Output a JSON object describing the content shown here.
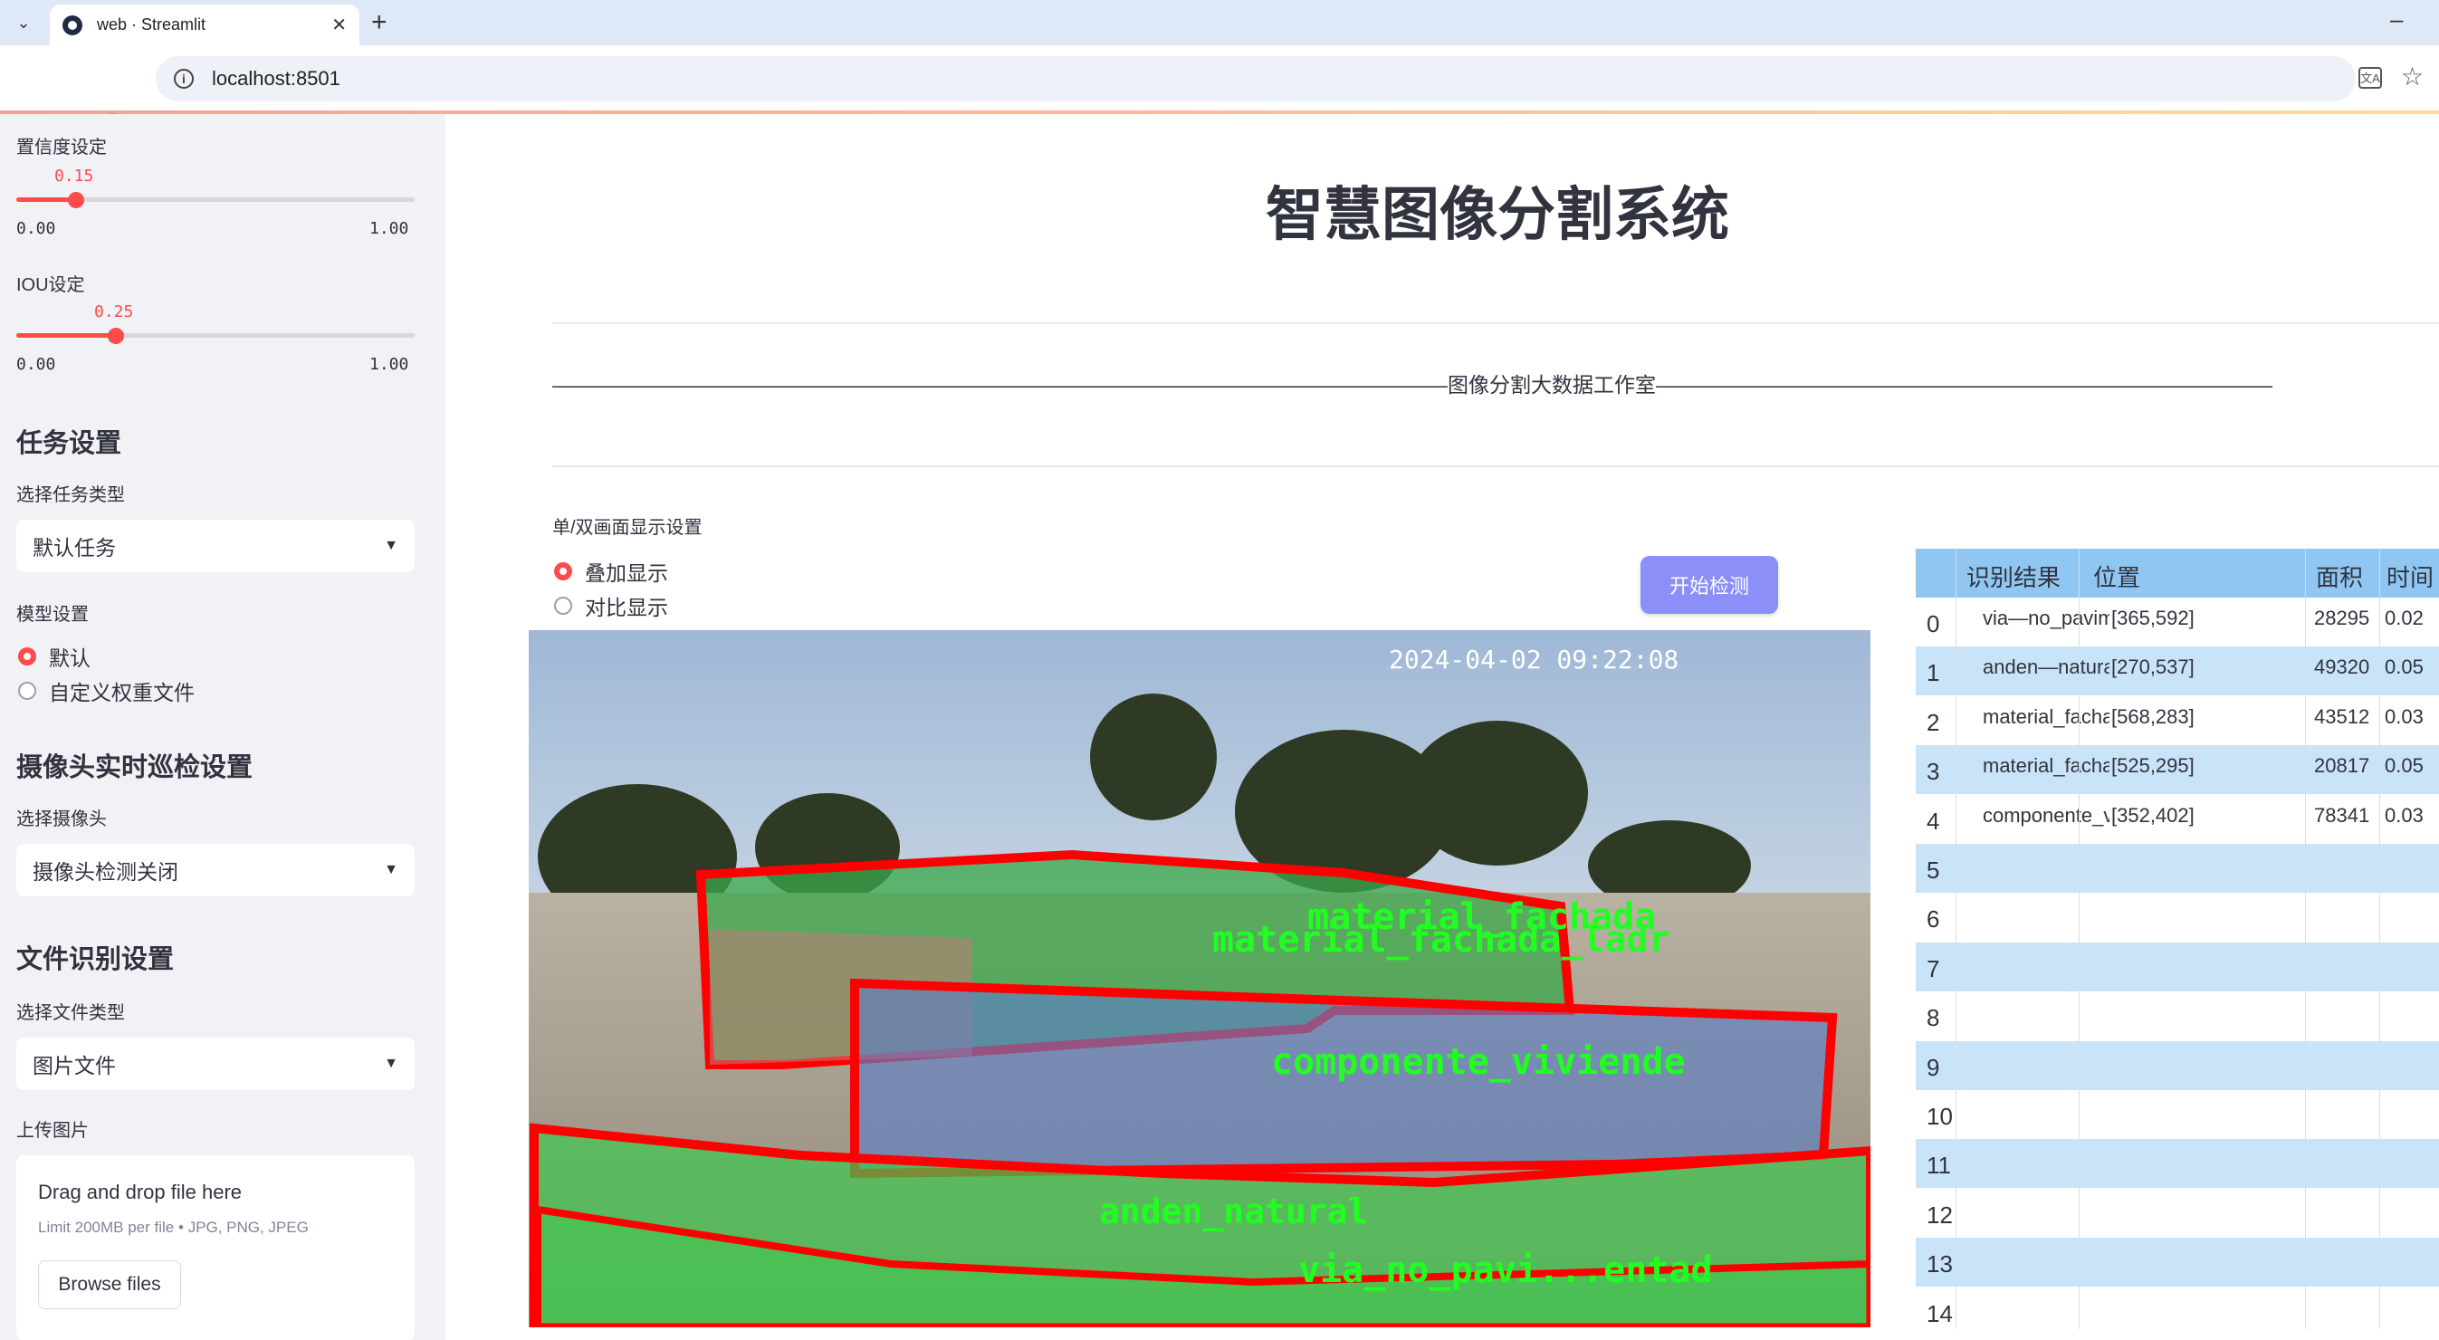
{
  "browser": {
    "tab_title": "web · Streamlit",
    "url": "localhost:8501"
  },
  "sidebar": {
    "confidence": {
      "label": "置信度设定",
      "value": "0.15",
      "min": "0.00",
      "max": "1.00",
      "fraction": 0.15
    },
    "iou": {
      "label": "IOU设定",
      "value": "0.25",
      "min": "0.00",
      "max": "1.00",
      "fraction": 0.25
    },
    "task_header": "任务设置",
    "task_type_label": "选择任务类型",
    "task_type_value": "默认任务",
    "model_label": "模型设置",
    "model_options": [
      "默认",
      "自定义权重文件"
    ],
    "camera_header": "摄像头实时巡检设置",
    "camera_label": "选择摄像头",
    "camera_value": "摄像头检测关闭",
    "file_header": "文件识别设置",
    "file_type_label": "选择文件类型",
    "file_type_value": "图片文件",
    "upload_label": "上传图片",
    "uploader": {
      "title": "Drag and drop file here",
      "subtitle": "Limit 200MB per file • JPG, PNG, JPEG",
      "button": "Browse files"
    }
  },
  "main": {
    "title": "智慧图像分割系统",
    "studio_line": "———————————————————————————————————————————图像分割大数据工作室——————————————————————————————————————————",
    "display_label": "单/双画面显示设置",
    "display_options": [
      "叠加显示",
      "对比显示"
    ],
    "start_button": "开始检测",
    "image": {
      "timestamp": "2024-04-02 09:22:08",
      "labels": [
        "material_fachada_ladrillo_pintura",
        "material_fachada_ladrillo_arcilla",
        "componente_vivienda",
        "anden_natural",
        "via_no_pavimentada"
      ],
      "labels_display": [
        "material_fachada",
        "material_fachada_ladr",
        "componente_viviende",
        "anden_natural",
        "via_no_pavi...entad"
      ]
    }
  },
  "table": {
    "headers": [
      "识别结果",
      "位置",
      "面积",
      "时间"
    ],
    "rows": [
      {
        "index": "0",
        "result": "via—no_pavimentada",
        "position": "[365,592]",
        "area": "28295",
        "time": "0.02"
      },
      {
        "index": "1",
        "result": "anden—natural",
        "position": "[270,537]",
        "area": "49320",
        "time": "0.05"
      },
      {
        "index": "2",
        "result": "material_fachada_ladrillo_pintura",
        "position": "[568,283]",
        "area": "43512",
        "time": "0.03"
      },
      {
        "index": "3",
        "result": "material_fachada_ladrillo_arcilla",
        "position": "[525,295]",
        "area": "20817",
        "time": "0.05"
      },
      {
        "index": "4",
        "result": "componente_vivienda_muralla_reja_metalica",
        "position": "[352,402]",
        "area": "78341",
        "time": "0.03"
      },
      {
        "index": "5"
      },
      {
        "index": "6"
      },
      {
        "index": "7"
      },
      {
        "index": "8"
      },
      {
        "index": "9"
      },
      {
        "index": "10"
      },
      {
        "index": "11"
      },
      {
        "index": "12"
      },
      {
        "index": "13"
      },
      {
        "index": "14"
      }
    ]
  },
  "colors": {
    "accent": "#ff4b4b",
    "button": "#8b8ff7",
    "table_header": "#8fc7f2",
    "table_alt": "#c9e4f8",
    "mask_green": "#2ecc40",
    "outline_red": "#ff0000"
  }
}
